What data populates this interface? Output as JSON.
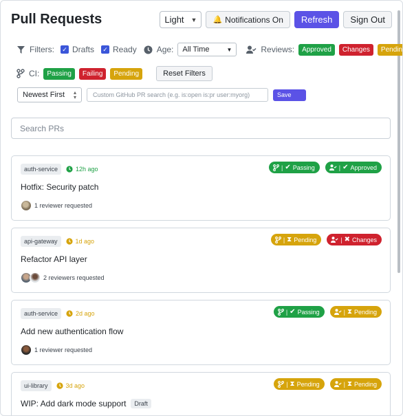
{
  "header": {
    "title": "Pull Requests",
    "theme_select": "Light",
    "notifications_label": "Notifications On",
    "refresh_label": "Refresh",
    "signout_label": "Sign Out"
  },
  "filters": {
    "filters_label": "Filters:",
    "drafts_label": "Drafts",
    "ready_label": "Ready",
    "age_label": "Age:",
    "age_value": "All Time",
    "reviews_label": "Reviews:",
    "reviews": [
      "Approved",
      "Changes",
      "Pending"
    ],
    "ci_label": "CI:",
    "ci": [
      "Passing",
      "Failing",
      "Pending"
    ],
    "reset_label": "Reset Filters",
    "sort_value": "Newest First",
    "gh_search_placeholder": "Custom GitHub PR search (e.g. is:open is:pr user:myorg)",
    "save_label": "Save"
  },
  "search": {
    "placeholder": "Search PRs"
  },
  "prs": [
    {
      "repo": "auth-service",
      "age": "12h ago",
      "title": "Hotfix: Security patch",
      "draft": "",
      "reviewers": "1 reviewer requested",
      "ci": "Passing",
      "review": "Approved"
    },
    {
      "repo": "api-gateway",
      "age": "1d ago",
      "title": "Refactor API layer",
      "draft": "",
      "reviewers": "2 reviewers requested",
      "ci": "Pending",
      "review": "Changes"
    },
    {
      "repo": "auth-service",
      "age": "2d ago",
      "title": "Add new authentication flow",
      "draft": "",
      "reviewers": "1 reviewer requested",
      "ci": "Passing",
      "review": "Pending"
    },
    {
      "repo": "ui-library",
      "age": "3d ago",
      "title": "WIP: Add dark mode support",
      "draft": "Draft",
      "reviewers": "",
      "ci": "Pending",
      "review": "Pending"
    }
  ],
  "colors": {
    "accent": "#5b52e6",
    "success": "#1fa146",
    "danger": "#cf222e",
    "warning": "#d6a40c"
  }
}
